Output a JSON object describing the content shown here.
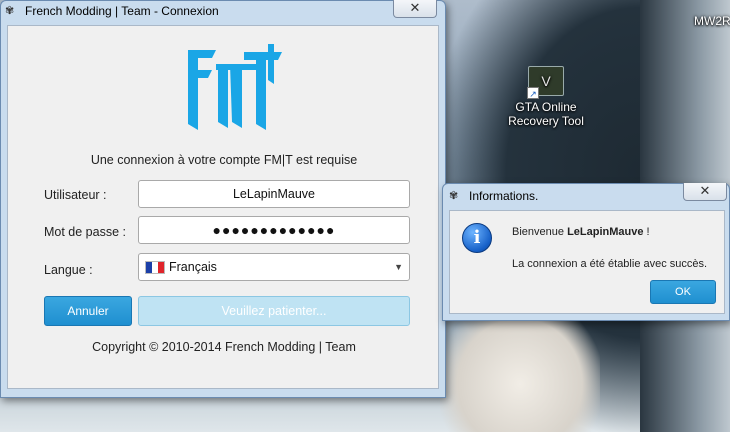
{
  "desktop": {
    "icons": [
      {
        "label_line1": "GTA Online",
        "label_line2": "Recovery Tool",
        "icon": "gta-v-icon"
      },
      {
        "label": "MW2R",
        "icon": "mw2-shortcut"
      }
    ]
  },
  "login_window": {
    "title": "French Modding | Team - Connexion",
    "close_label": "✕",
    "subtitle": "Une connexion à votre compte FM|T est requise",
    "username_label": "Utilisateur :",
    "username_value": "LeLapinMauve",
    "password_label": "Mot de passe :",
    "password_value": "●●●●●●●●●●●●●",
    "language_label": "Langue :",
    "language_value": "Français",
    "cancel_label": "Annuler",
    "wait_label": "Veuillez patienter...",
    "copyright": "Copyright © 2010-2014 French Modding | Team",
    "colors": {
      "accent": "#1f8fd0",
      "logo": "#1aa6e6"
    }
  },
  "info_dialog": {
    "title": "Informations.",
    "close_label": "✕",
    "welcome_prefix": "Bienvenue",
    "welcome_user": "LeLapinMauve",
    "welcome_suffix": "!",
    "message": "La connexion a été établie avec succès.",
    "ok_label": "OK"
  }
}
